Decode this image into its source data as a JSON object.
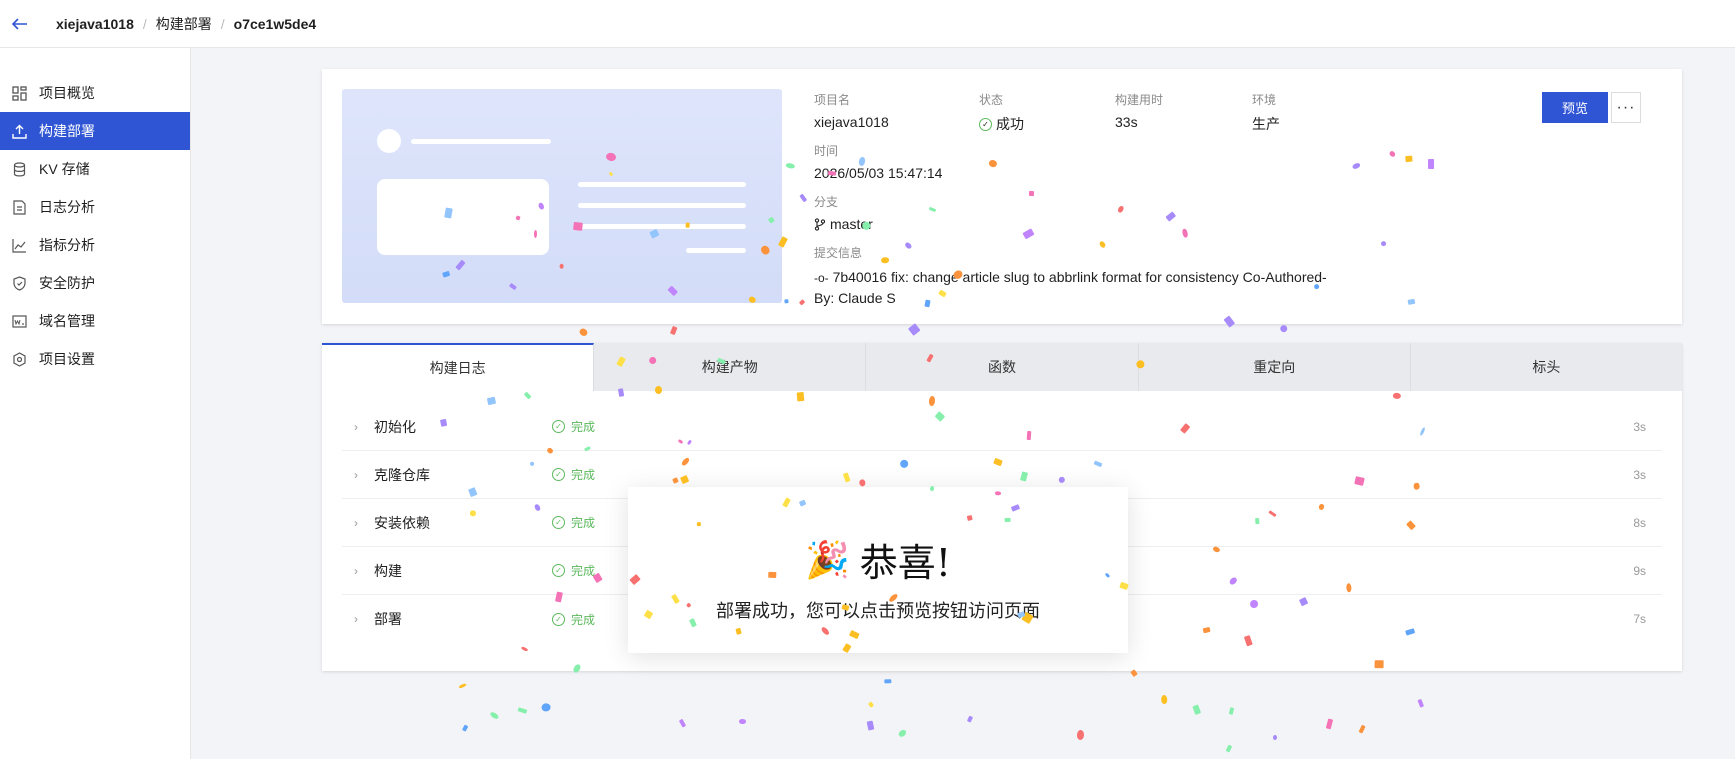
{
  "header": {
    "back_icon": "arrow-left-icon",
    "breadcrumb": [
      "xiejava1018",
      "构建部署",
      "o7ce1w5de4"
    ]
  },
  "sidebar": {
    "items": [
      {
        "label": "项目概览",
        "icon": "dashboard-icon",
        "active": false
      },
      {
        "label": "构建部署",
        "icon": "upload-icon",
        "active": true
      },
      {
        "label": "KV 存储",
        "icon": "database-icon",
        "active": false
      },
      {
        "label": "日志分析",
        "icon": "document-icon",
        "active": false
      },
      {
        "label": "指标分析",
        "icon": "line-chart-icon",
        "active": false
      },
      {
        "label": "安全防护",
        "icon": "shield-icon",
        "active": false
      },
      {
        "label": "域名管理",
        "icon": "domain-icon",
        "active": false
      },
      {
        "label": "项目设置",
        "icon": "settings-icon",
        "active": false
      }
    ]
  },
  "deployment": {
    "project_label": "项目名",
    "project": "xiejava1018",
    "status_label": "状态",
    "status": "成功",
    "duration_label": "构建用时",
    "duration": "33s",
    "env_label": "环境",
    "env": "生产",
    "time_label": "时间",
    "time": "2026/05/03 15:47:14",
    "branch_label": "分支",
    "branch": "master",
    "commit_label": "提交信息",
    "commit_line1": "7b40016 fix: change article slug to abbrlink format for consistency Co-Authored-",
    "commit_line2": "By: Claude S",
    "preview_label": "预览",
    "more_label": "···"
  },
  "tabs": [
    "构建日志",
    "构建产物",
    "函数",
    "重定向",
    "标头"
  ],
  "steps": [
    {
      "name": "初始化",
      "status": "完成",
      "duration": "3s"
    },
    {
      "name": "克隆仓库",
      "status": "完成",
      "duration": "3s"
    },
    {
      "name": "安装依赖",
      "status": "完成",
      "duration": "8s"
    },
    {
      "name": "构建",
      "status": "完成",
      "duration": "9s"
    },
    {
      "name": "部署",
      "status": "完成",
      "duration": "7s"
    }
  ],
  "modal": {
    "icon": "party-popper-icon",
    "title": "恭喜!",
    "message": "部署成功，您可以点击预览按钮访问页面"
  },
  "colors": {
    "accent": "#2f55d4",
    "success": "#5cb85c"
  }
}
